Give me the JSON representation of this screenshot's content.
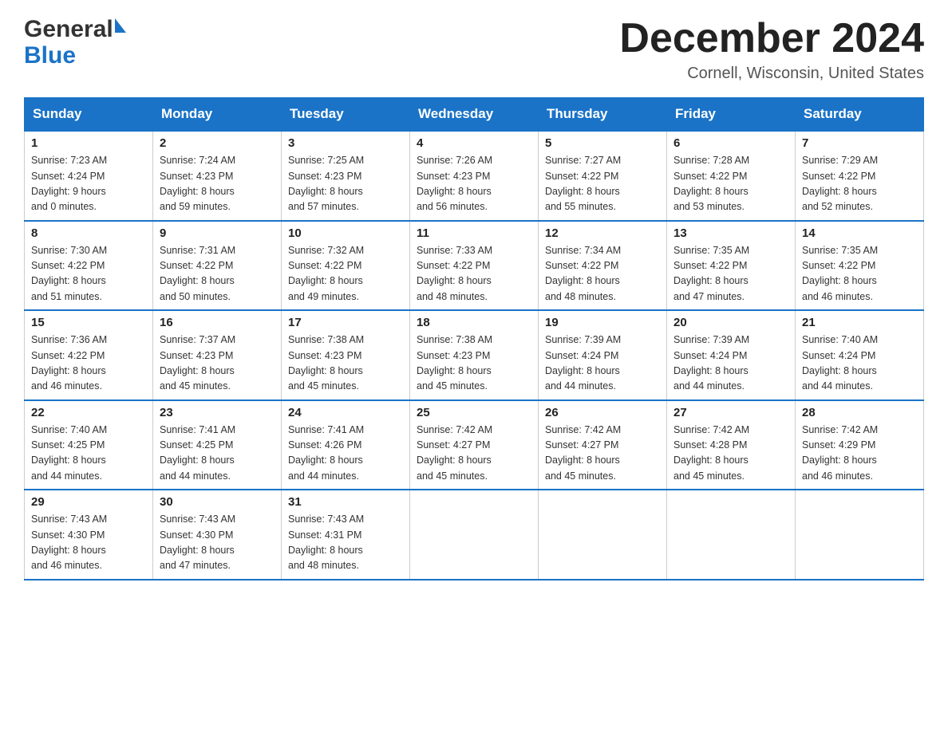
{
  "header": {
    "logo_general": "General",
    "logo_blue": "Blue",
    "month_title": "December 2024",
    "subtitle": "Cornell, Wisconsin, United States"
  },
  "weekdays": [
    "Sunday",
    "Monday",
    "Tuesday",
    "Wednesday",
    "Thursday",
    "Friday",
    "Saturday"
  ],
  "weeks": [
    [
      {
        "day": "1",
        "sunrise": "7:23 AM",
        "sunset": "4:24 PM",
        "daylight": "9 hours and 0 minutes."
      },
      {
        "day": "2",
        "sunrise": "7:24 AM",
        "sunset": "4:23 PM",
        "daylight": "8 hours and 59 minutes."
      },
      {
        "day": "3",
        "sunrise": "7:25 AM",
        "sunset": "4:23 PM",
        "daylight": "8 hours and 57 minutes."
      },
      {
        "day": "4",
        "sunrise": "7:26 AM",
        "sunset": "4:23 PM",
        "daylight": "8 hours and 56 minutes."
      },
      {
        "day": "5",
        "sunrise": "7:27 AM",
        "sunset": "4:22 PM",
        "daylight": "8 hours and 55 minutes."
      },
      {
        "day": "6",
        "sunrise": "7:28 AM",
        "sunset": "4:22 PM",
        "daylight": "8 hours and 53 minutes."
      },
      {
        "day": "7",
        "sunrise": "7:29 AM",
        "sunset": "4:22 PM",
        "daylight": "8 hours and 52 minutes."
      }
    ],
    [
      {
        "day": "8",
        "sunrise": "7:30 AM",
        "sunset": "4:22 PM",
        "daylight": "8 hours and 51 minutes."
      },
      {
        "day": "9",
        "sunrise": "7:31 AM",
        "sunset": "4:22 PM",
        "daylight": "8 hours and 50 minutes."
      },
      {
        "day": "10",
        "sunrise": "7:32 AM",
        "sunset": "4:22 PM",
        "daylight": "8 hours and 49 minutes."
      },
      {
        "day": "11",
        "sunrise": "7:33 AM",
        "sunset": "4:22 PM",
        "daylight": "8 hours and 48 minutes."
      },
      {
        "day": "12",
        "sunrise": "7:34 AM",
        "sunset": "4:22 PM",
        "daylight": "8 hours and 48 minutes."
      },
      {
        "day": "13",
        "sunrise": "7:35 AM",
        "sunset": "4:22 PM",
        "daylight": "8 hours and 47 minutes."
      },
      {
        "day": "14",
        "sunrise": "7:35 AM",
        "sunset": "4:22 PM",
        "daylight": "8 hours and 46 minutes."
      }
    ],
    [
      {
        "day": "15",
        "sunrise": "7:36 AM",
        "sunset": "4:22 PM",
        "daylight": "8 hours and 46 minutes."
      },
      {
        "day": "16",
        "sunrise": "7:37 AM",
        "sunset": "4:23 PM",
        "daylight": "8 hours and 45 minutes."
      },
      {
        "day": "17",
        "sunrise": "7:38 AM",
        "sunset": "4:23 PM",
        "daylight": "8 hours and 45 minutes."
      },
      {
        "day": "18",
        "sunrise": "7:38 AM",
        "sunset": "4:23 PM",
        "daylight": "8 hours and 45 minutes."
      },
      {
        "day": "19",
        "sunrise": "7:39 AM",
        "sunset": "4:24 PM",
        "daylight": "8 hours and 44 minutes."
      },
      {
        "day": "20",
        "sunrise": "7:39 AM",
        "sunset": "4:24 PM",
        "daylight": "8 hours and 44 minutes."
      },
      {
        "day": "21",
        "sunrise": "7:40 AM",
        "sunset": "4:24 PM",
        "daylight": "8 hours and 44 minutes."
      }
    ],
    [
      {
        "day": "22",
        "sunrise": "7:40 AM",
        "sunset": "4:25 PM",
        "daylight": "8 hours and 44 minutes."
      },
      {
        "day": "23",
        "sunrise": "7:41 AM",
        "sunset": "4:25 PM",
        "daylight": "8 hours and 44 minutes."
      },
      {
        "day": "24",
        "sunrise": "7:41 AM",
        "sunset": "4:26 PM",
        "daylight": "8 hours and 44 minutes."
      },
      {
        "day": "25",
        "sunrise": "7:42 AM",
        "sunset": "4:27 PM",
        "daylight": "8 hours and 45 minutes."
      },
      {
        "day": "26",
        "sunrise": "7:42 AM",
        "sunset": "4:27 PM",
        "daylight": "8 hours and 45 minutes."
      },
      {
        "day": "27",
        "sunrise": "7:42 AM",
        "sunset": "4:28 PM",
        "daylight": "8 hours and 45 minutes."
      },
      {
        "day": "28",
        "sunrise": "7:42 AM",
        "sunset": "4:29 PM",
        "daylight": "8 hours and 46 minutes."
      }
    ],
    [
      {
        "day": "29",
        "sunrise": "7:43 AM",
        "sunset": "4:30 PM",
        "daylight": "8 hours and 46 minutes."
      },
      {
        "day": "30",
        "sunrise": "7:43 AM",
        "sunset": "4:30 PM",
        "daylight": "8 hours and 47 minutes."
      },
      {
        "day": "31",
        "sunrise": "7:43 AM",
        "sunset": "4:31 PM",
        "daylight": "8 hours and 48 minutes."
      },
      null,
      null,
      null,
      null
    ]
  ],
  "labels": {
    "sunrise": "Sunrise:",
    "sunset": "Sunset:",
    "daylight": "Daylight:"
  }
}
